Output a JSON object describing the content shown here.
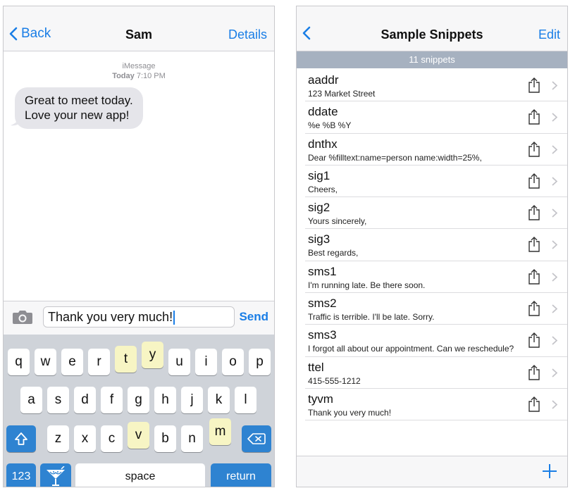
{
  "messages_screen": {
    "nav": {
      "back_label": "Back",
      "title": "Sam",
      "details_label": "Details"
    },
    "meta": {
      "service": "iMessage",
      "day": "Today",
      "time": "7:10 PM"
    },
    "bubble": {
      "line1": "Great to meet today.",
      "line2": "Love your new app!"
    },
    "input": {
      "value": "Thank you very much!",
      "send_label": "Send"
    },
    "keyboard": {
      "row1": [
        "q",
        "w",
        "e",
        "r",
        "t",
        "y",
        "u",
        "i",
        "o",
        "p"
      ],
      "row2": [
        "a",
        "s",
        "d",
        "f",
        "g",
        "h",
        "j",
        "k",
        "l"
      ],
      "row3": [
        "z",
        "x",
        "c",
        "v",
        "b",
        "n",
        "m"
      ],
      "numbers_label": "123",
      "space_label": "space",
      "return_label": "return",
      "highlighted_keys": [
        "t",
        "y",
        "v",
        "m"
      ]
    }
  },
  "snippets_screen": {
    "nav": {
      "title": "Sample Snippets",
      "edit_label": "Edit"
    },
    "count_label": "11 snippets",
    "snippets": [
      {
        "name": "aaddr",
        "text": "123 Market Street"
      },
      {
        "name": "ddate",
        "text": "%e %B %Y"
      },
      {
        "name": "dnthx",
        "text": "Dear %filltext:name=person name:width=25%,"
      },
      {
        "name": "sig1",
        "text": "Cheers,"
      },
      {
        "name": "sig2",
        "text": "Yours sincerely,"
      },
      {
        "name": "sig3",
        "text": "Best regards,"
      },
      {
        "name": "sms1",
        "text": "I'm running late. Be there soon."
      },
      {
        "name": "sms2",
        "text": "Traffic is terrible. I'll be late. Sorry."
      },
      {
        "name": "sms3",
        "text": "I forgot all about our appointment. Can we reschedule?"
      },
      {
        "name": "ttel",
        "text": "415-555-1212"
      },
      {
        "name": "tyvm",
        "text": "Thank you very much!"
      }
    ]
  },
  "colors": {
    "accent": "#1a7ee6",
    "count_bar": "#a6b1c0",
    "key_highlight": "#f7f5c4",
    "func_key": "#2e83d1"
  }
}
